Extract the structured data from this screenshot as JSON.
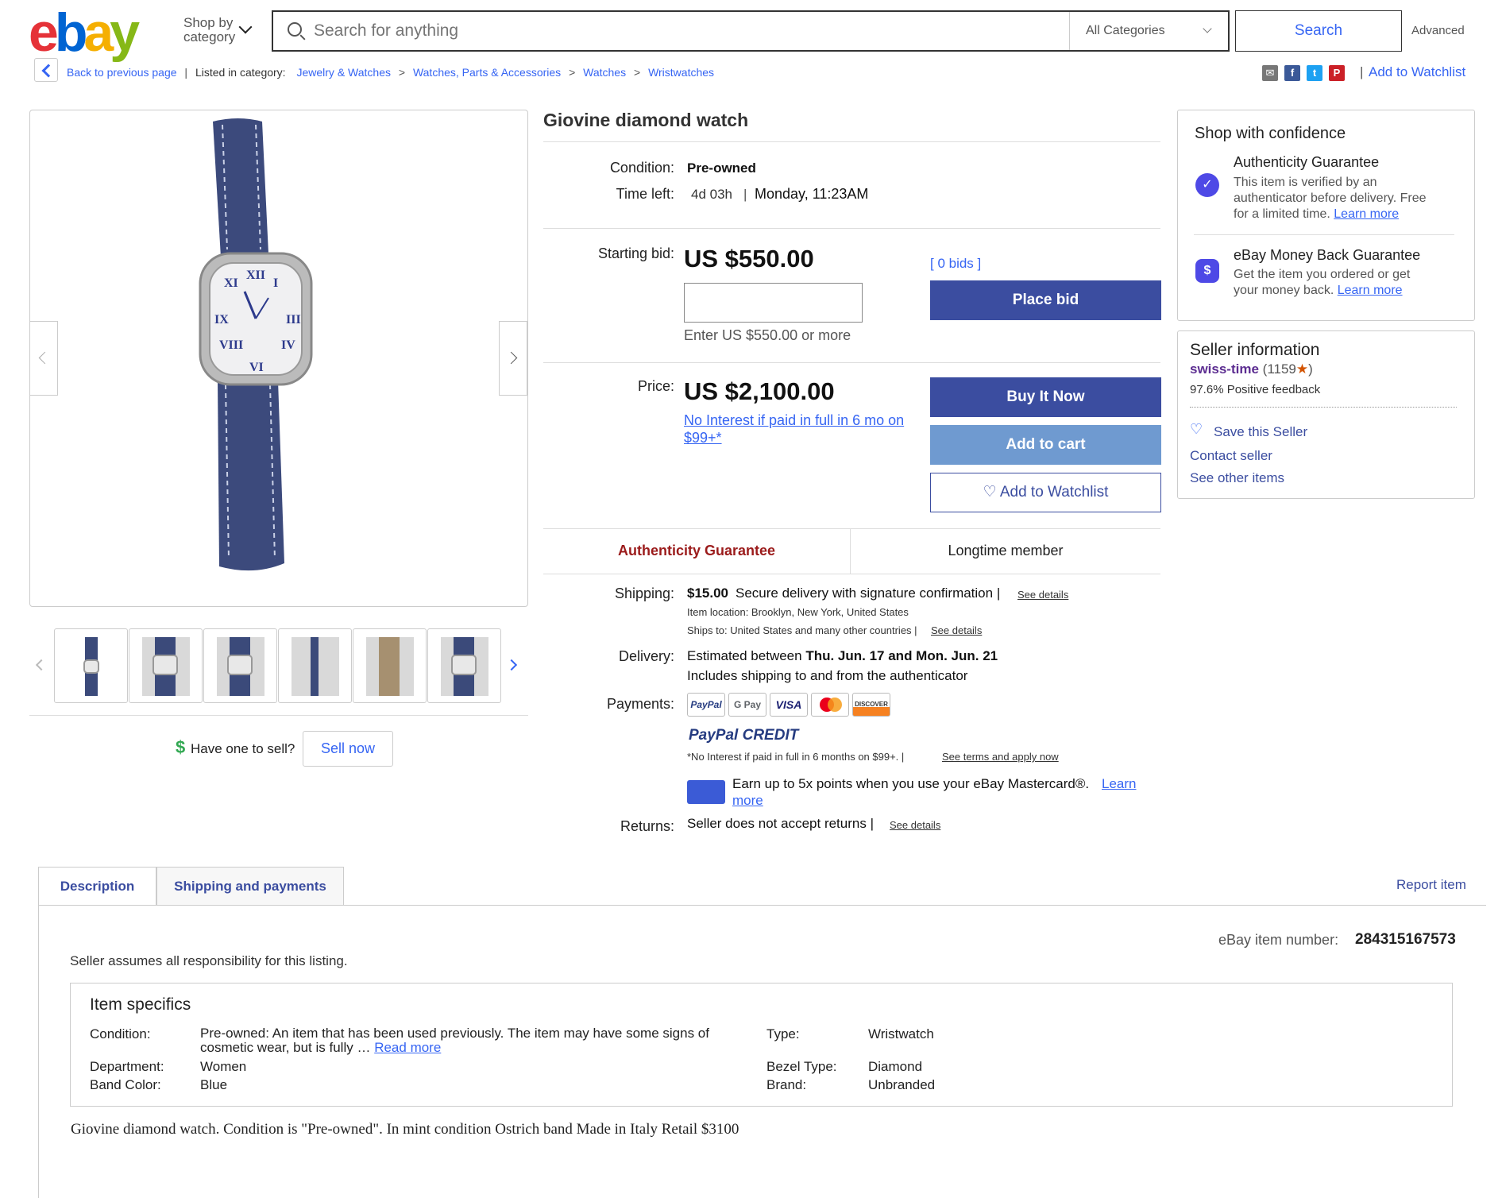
{
  "header": {
    "logo_letters": [
      "e",
      "b",
      "a",
      "y"
    ],
    "shop_by_line1": "Shop by",
    "shop_by_line2": "category",
    "search_placeholder": "Search for anything",
    "category_selected": "All Categories",
    "search_button": "Search",
    "advanced": "Advanced"
  },
  "breadcrumb": {
    "back": "Back to previous page",
    "listed_in": "Listed in category:",
    "items": [
      "Jewelry & Watches",
      "Watches, Parts & Accessories",
      "Watches",
      "Wristwatches"
    ],
    "add_to_watchlist": "Add to Watchlist"
  },
  "gallery": {
    "thumb_count": 6,
    "have_one": "Have one to sell?",
    "sell_now": "Sell now"
  },
  "listing": {
    "title": "Giovine diamond watch",
    "condition_label": "Condition:",
    "condition_value": "Pre-owned",
    "time_left_label": "Time left:",
    "time_left_value": "4d 03h",
    "time_left_end": "Monday, 11:23AM",
    "starting_bid_label": "Starting bid:",
    "starting_bid_value": "US $550.00",
    "bids": "[ 0 bids ]",
    "bid_hint": "Enter US $550.00 or more",
    "place_bid": "Place bid",
    "price_label": "Price:",
    "price_value": "US $2,100.00",
    "financing_line1": "No Interest if paid in full in 6 mo on",
    "financing_line2": "$99+*",
    "buy_it_now": "Buy It Now",
    "add_to_cart": "Add to cart",
    "add_to_watchlist": "Add to Watchlist",
    "authenticity_badge": "Authenticity Guarantee",
    "longtime_badge": "Longtime member"
  },
  "shipping": {
    "shipping_label": "Shipping:",
    "shipping_cost": "$15.00",
    "shipping_desc": "Secure delivery with signature confirmation |",
    "see_details": "See details",
    "item_location": "Item location:  Brooklyn, New York, United States",
    "ships_to": "Ships to:  United States and many other countries |",
    "delivery_label": "Delivery:",
    "delivery_prefix": "Estimated between",
    "delivery_dates": "Thu. Jun. 17 and Mon. Jun. 21",
    "delivery_note": "Includes shipping to and from the authenticator",
    "payments_label": "Payments:",
    "payment_methods": [
      "PayPal",
      "G Pay",
      "VISA",
      "Mastercard",
      "DISCOVER"
    ],
    "paypal_credit": "PayPal CREDIT",
    "credit_note": "*No Interest if paid in full in 6 months on $99+.  |",
    "credit_link": "See terms and apply now",
    "mastercard_line1": "Earn up to 5x points when you use your eBay Mastercard®.",
    "mastercard_link1": "Learn",
    "mastercard_link2": "more",
    "returns_label": "Returns:",
    "returns_value": "Seller does not accept returns |"
  },
  "confidence": {
    "title": "Shop with confidence",
    "auth_title": "Authenticity Guarantee",
    "auth_line1": "This item is verified by an",
    "auth_line2": "authenticator before delivery. Free",
    "auth_line3": "for a limited time.",
    "learn_more": "Learn more",
    "mbg_title": "eBay Money Back Guarantee",
    "mbg_line1": "Get the item you ordered or get",
    "mbg_line2": "your money back."
  },
  "seller": {
    "title": "Seller information",
    "name": "swiss-time",
    "score": "(1159",
    "score_close": ")",
    "feedback": "97.6% Positive feedback",
    "save": "Save this Seller",
    "contact": "Contact seller",
    "other": "See other items"
  },
  "tabs": {
    "description": "Description",
    "shipping": "Shipping and payments",
    "report": "Report item"
  },
  "description": {
    "item_number_label": "eBay item number:",
    "item_number": "284315167573",
    "responsibility": "Seller assumes all responsibility for this listing.",
    "specs_title": "Item specifics",
    "condition_label": "Condition:",
    "condition_line1": "Pre-owned: An item that has been used previously. The item may have some signs of",
    "condition_line2": "cosmetic wear, but is fully …",
    "read_more": "Read more",
    "department_label": "Department:",
    "department": "Women",
    "band_color_label": "Band Color:",
    "band_color": "Blue",
    "type_label": "Type:",
    "type": "Wristwatch",
    "bezel_label": "Bezel Type:",
    "bezel": "Diamond",
    "brand_label": "Brand:",
    "brand": "Unbranded",
    "text": "Giovine diamond watch. Condition is \"Pre-owned\". In mint condition Ostrich band Made in Italy Retail $3100"
  }
}
